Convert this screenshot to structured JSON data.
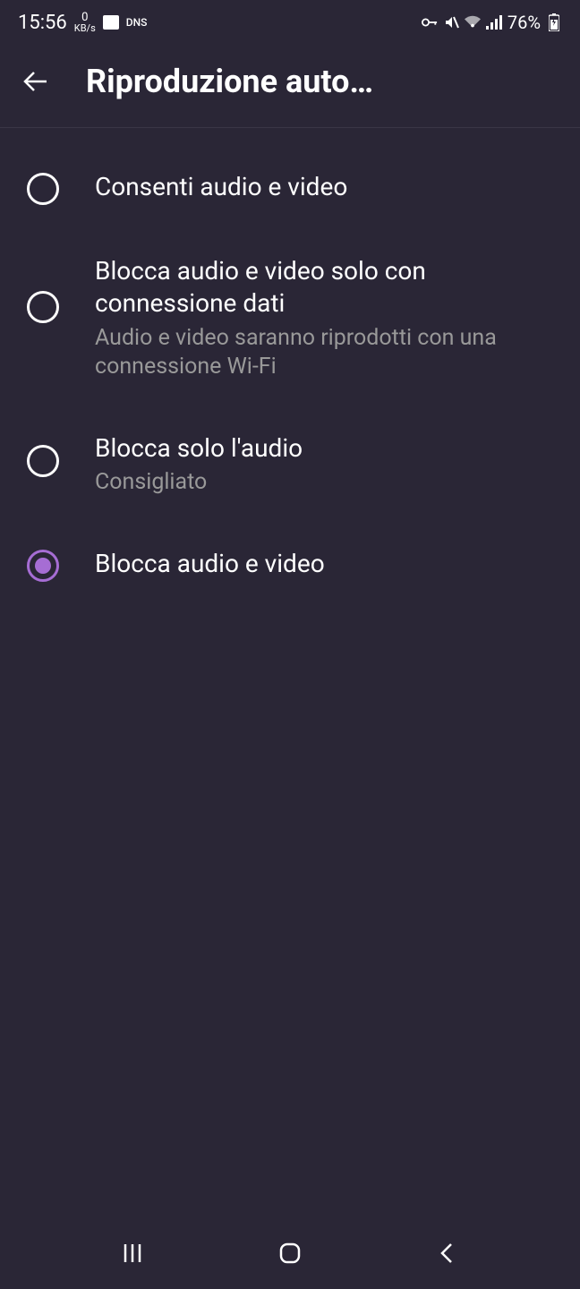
{
  "status_bar": {
    "time": "15:56",
    "kbs_num": "0",
    "kbs_label": "KB/s",
    "dns": "DNS",
    "battery": "76%"
  },
  "header": {
    "title": "Riproduzione auto…"
  },
  "options": [
    {
      "label": "Consenti audio e video",
      "sublabel": "",
      "selected": false
    },
    {
      "label": "Blocca audio e video solo con connessione dati",
      "sublabel": "Audio e video saranno riprodotti con una connessione Wi-Fi",
      "selected": false
    },
    {
      "label": "Blocca solo l'audio",
      "sublabel": "Consigliato",
      "selected": false
    },
    {
      "label": "Blocca audio e video",
      "sublabel": "",
      "selected": true
    }
  ],
  "colors": {
    "accent": "#a66dd4",
    "background": "#2a2636",
    "text_secondary": "#999"
  }
}
